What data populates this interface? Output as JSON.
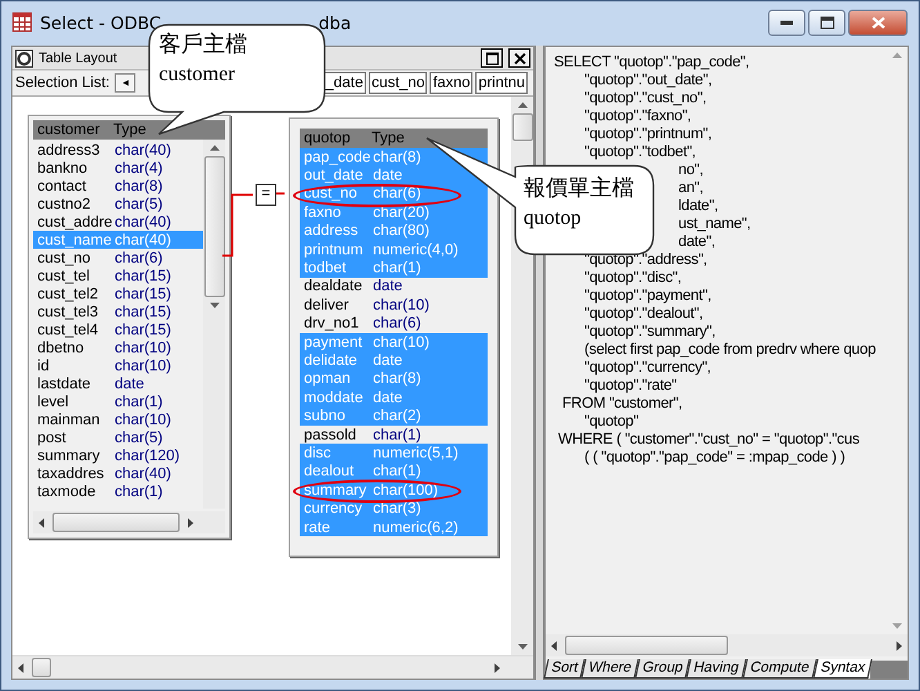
{
  "window": {
    "title": "Select - ODBC",
    "title_tail": "dba"
  },
  "table_layout": {
    "title": "Table Layout",
    "selection_label": "Selection List:",
    "scroll_left": "◄",
    "selection_items": [
      "_date",
      "cust_no",
      "faxno",
      "printnu"
    ]
  },
  "customer": {
    "name": "customer",
    "type_header": "Type",
    "rows": [
      {
        "name": "address3",
        "type": "char(40)",
        "selected": false
      },
      {
        "name": "bankno",
        "type": "char(4)",
        "selected": false
      },
      {
        "name": "contact",
        "type": "char(8)",
        "selected": false
      },
      {
        "name": "custno2",
        "type": "char(5)",
        "selected": false
      },
      {
        "name": "cust_addre",
        "type": "char(40)",
        "selected": false
      },
      {
        "name": "cust_name",
        "type": "char(40)",
        "selected": true
      },
      {
        "name": "cust_no",
        "type": "char(6)",
        "selected": false
      },
      {
        "name": "cust_tel",
        "type": "char(15)",
        "selected": false
      },
      {
        "name": "cust_tel2",
        "type": "char(15)",
        "selected": false
      },
      {
        "name": "cust_tel3",
        "type": "char(15)",
        "selected": false
      },
      {
        "name": "cust_tel4",
        "type": "char(15)",
        "selected": false
      },
      {
        "name": "dbetno",
        "type": "char(10)",
        "selected": false
      },
      {
        "name": "id",
        "type": "char(10)",
        "selected": false
      },
      {
        "name": "lastdate",
        "type": "date",
        "selected": false
      },
      {
        "name": "level",
        "type": "char(1)",
        "selected": false
      },
      {
        "name": "mainman",
        "type": "char(10)",
        "selected": false
      },
      {
        "name": "post",
        "type": "char(5)",
        "selected": false
      },
      {
        "name": "summary",
        "type": "char(120)",
        "selected": false
      },
      {
        "name": "taxaddres",
        "type": "char(40)",
        "selected": false
      },
      {
        "name": "taxmode",
        "type": "char(1)",
        "selected": false
      }
    ]
  },
  "join_operator": "=",
  "quotop": {
    "name": "quotop",
    "type_header": "Type",
    "rows": [
      {
        "name": "pap_code",
        "type": "char(8)",
        "selected": true,
        "circled": false
      },
      {
        "name": "out_date",
        "type": "date",
        "selected": true,
        "circled": false
      },
      {
        "name": "cust_no",
        "type": "char(6)",
        "selected": true,
        "circled": true
      },
      {
        "name": "faxno",
        "type": "char(20)",
        "selected": true,
        "circled": false
      },
      {
        "name": "address",
        "type": "char(80)",
        "selected": true,
        "circled": false
      },
      {
        "name": "printnum",
        "type": "numeric(4,0)",
        "selected": true,
        "circled": false
      },
      {
        "name": "todbet",
        "type": "char(1)",
        "selected": true,
        "circled": false
      },
      {
        "name": "dealdate",
        "type": "date",
        "selected": false,
        "circled": false
      },
      {
        "name": "deliver",
        "type": "char(10)",
        "selected": false,
        "circled": false
      },
      {
        "name": "drv_no1",
        "type": "char(6)",
        "selected": false,
        "circled": false
      },
      {
        "name": "payment",
        "type": "char(10)",
        "selected": true,
        "circled": false
      },
      {
        "name": "delidate",
        "type": "date",
        "selected": true,
        "circled": false
      },
      {
        "name": "opman",
        "type": "char(8)",
        "selected": true,
        "circled": false
      },
      {
        "name": "moddate",
        "type": "date",
        "selected": true,
        "circled": false
      },
      {
        "name": "subno",
        "type": "char(2)",
        "selected": true,
        "circled": false
      },
      {
        "name": "passold",
        "type": "char(1)",
        "selected": false,
        "circled": false
      },
      {
        "name": "disc",
        "type": "numeric(5,1)",
        "selected": true,
        "circled": false
      },
      {
        "name": "dealout",
        "type": "char(1)",
        "selected": true,
        "circled": false
      },
      {
        "name": "summary",
        "type": "char(100)",
        "selected": true,
        "circled": true
      },
      {
        "name": "currency",
        "type": "char(3)",
        "selected": true,
        "circled": false
      },
      {
        "name": "rate",
        "type": "numeric(6,2)",
        "selected": true,
        "circled": false
      }
    ]
  },
  "callouts": [
    {
      "title": "客戶主檔",
      "subtitle": "customer"
    },
    {
      "title": "報價單主檔",
      "subtitle": "quotop"
    }
  ],
  "sql_lines": [
    {
      "kind": "head",
      "text": "SELECT \"quotop\".\"pap_code\","
    },
    {
      "kind": "col",
      "text": "\"quotop\".\"out_date\","
    },
    {
      "kind": "col",
      "text": "\"quotop\".\"cust_no\","
    },
    {
      "kind": "col",
      "text": "\"quotop\".\"faxno\","
    },
    {
      "kind": "col",
      "text": "\"quotop\".\"printnum\","
    },
    {
      "kind": "col",
      "text": "\"quotop\".\"todbet\","
    },
    {
      "kind": "covered",
      "text": "no\","
    },
    {
      "kind": "covered",
      "text": "an\","
    },
    {
      "kind": "covered",
      "text": "ldate\","
    },
    {
      "kind": "covered",
      "text": "ust_name\","
    },
    {
      "kind": "covered",
      "text": "date\","
    },
    {
      "kind": "col",
      "text": "\"quotop\".\"address\","
    },
    {
      "kind": "col",
      "text": "\"quotop\".\"disc\","
    },
    {
      "kind": "col",
      "text": "\"quotop\".\"payment\","
    },
    {
      "kind": "col",
      "text": "\"quotop\".\"dealout\","
    },
    {
      "kind": "col",
      "text": "\"quotop\".\"summary\","
    },
    {
      "kind": "col",
      "text": "(select first pap_code from predrv where quop"
    },
    {
      "kind": "col",
      "text": "\"quotop\".\"currency\","
    },
    {
      "kind": "col",
      "text": "\"quotop\".\"rate\""
    },
    {
      "kind": "from",
      "text": "FROM \"customer\","
    },
    {
      "kind": "col",
      "text": "\"quotop\""
    },
    {
      "kind": "where",
      "text": "WHERE ( \"customer\".\"cust_no\" = \"quotop\".\"cus"
    },
    {
      "kind": "col",
      "text": "( ( \"quotop\".\"pap_code\" = :mpap_code ) )"
    }
  ],
  "tabs": [
    {
      "label": "Sort",
      "selected": false
    },
    {
      "label": "Where",
      "selected": false
    },
    {
      "label": "Group",
      "selected": false
    },
    {
      "label": "Having",
      "selected": false
    },
    {
      "label": "Compute",
      "selected": false
    },
    {
      "label": "Syntax",
      "selected": true
    }
  ]
}
